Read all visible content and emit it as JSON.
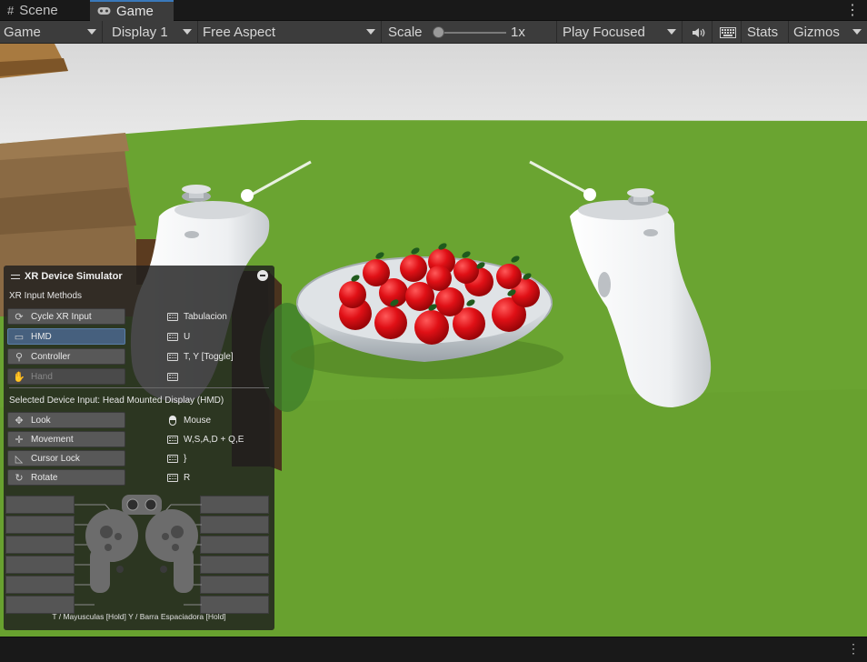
{
  "tabs": [
    {
      "label": "Scene",
      "icon": "grid-icon"
    },
    {
      "label": "Game",
      "icon": "gamepad-icon"
    }
  ],
  "toolbar": {
    "mode": "Game",
    "display": "Display 1",
    "aspect": "Free Aspect",
    "scale_label": "Scale",
    "scale_value": "1x",
    "play_mode": "Play Focused",
    "stats": "Stats",
    "gizmos": "Gizmos"
  },
  "xr_panel": {
    "title": "XR Device Simulator",
    "input_methods_heading": "XR Input Methods",
    "input_methods": [
      {
        "label": "Cycle XR Input",
        "key": "Tabulacion",
        "icon": "cycle-icon",
        "state": "normal"
      },
      {
        "label": "HMD",
        "key": "U",
        "icon": "hmd-icon",
        "state": "active"
      },
      {
        "label": "Controller",
        "key": "T, Y [Toggle]",
        "icon": "controller-icon",
        "state": "normal"
      },
      {
        "label": "Hand",
        "key": "",
        "icon": "hand-icon",
        "state": "disabled"
      }
    ],
    "selected_device_label": "Selected Device Input:",
    "selected_device_value": "Head Mounted Display (HMD)",
    "device_inputs": [
      {
        "label": "Look",
        "key": "Mouse",
        "icon": "look-icon",
        "key_icon": "mouse"
      },
      {
        "label": "Movement",
        "key": "W,S,A,D + Q,E",
        "icon": "move-icon",
        "key_icon": "keyboard"
      },
      {
        "label": "Cursor Lock",
        "key": "}",
        "icon": "cursor-icon",
        "key_icon": "keyboard"
      },
      {
        "label": "Rotate",
        "key": "R",
        "icon": "rotate-icon",
        "key_icon": "keyboard"
      }
    ],
    "footer": "T / Mayusculas [Hold]  Y / Barra Espaciadora [Hold]"
  },
  "colors": {
    "accent": "#3a79bb",
    "grass": "#6aa431",
    "apple": "#d90f14",
    "panel": "#1e1e1e"
  }
}
